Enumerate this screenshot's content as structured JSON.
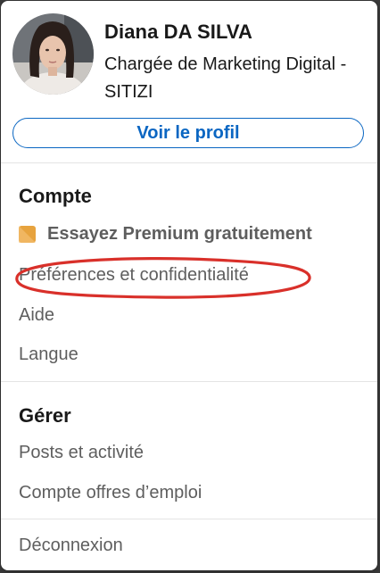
{
  "profile": {
    "name": "Diana DA SILVA",
    "headline": "Chargée de Marketing Digital - SITIZI",
    "view_profile_label": "Voir le profil"
  },
  "account": {
    "title": "Compte",
    "premium_label": "Essayez Premium gratuitement",
    "items": [
      {
        "label": "Préférences et confidentialité"
      },
      {
        "label": "Aide"
      },
      {
        "label": "Langue"
      }
    ]
  },
  "manage": {
    "title": "Gérer",
    "items": [
      {
        "label": "Posts et activité"
      },
      {
        "label": "Compte offres d’emploi"
      }
    ]
  },
  "signout_label": "Déconnexion",
  "colors": {
    "accent": "#0a66c2",
    "premium_gold": "#e7a33e",
    "annotation_red": "#d9302a"
  },
  "icons": {
    "premium": "premium-badge-icon"
  }
}
